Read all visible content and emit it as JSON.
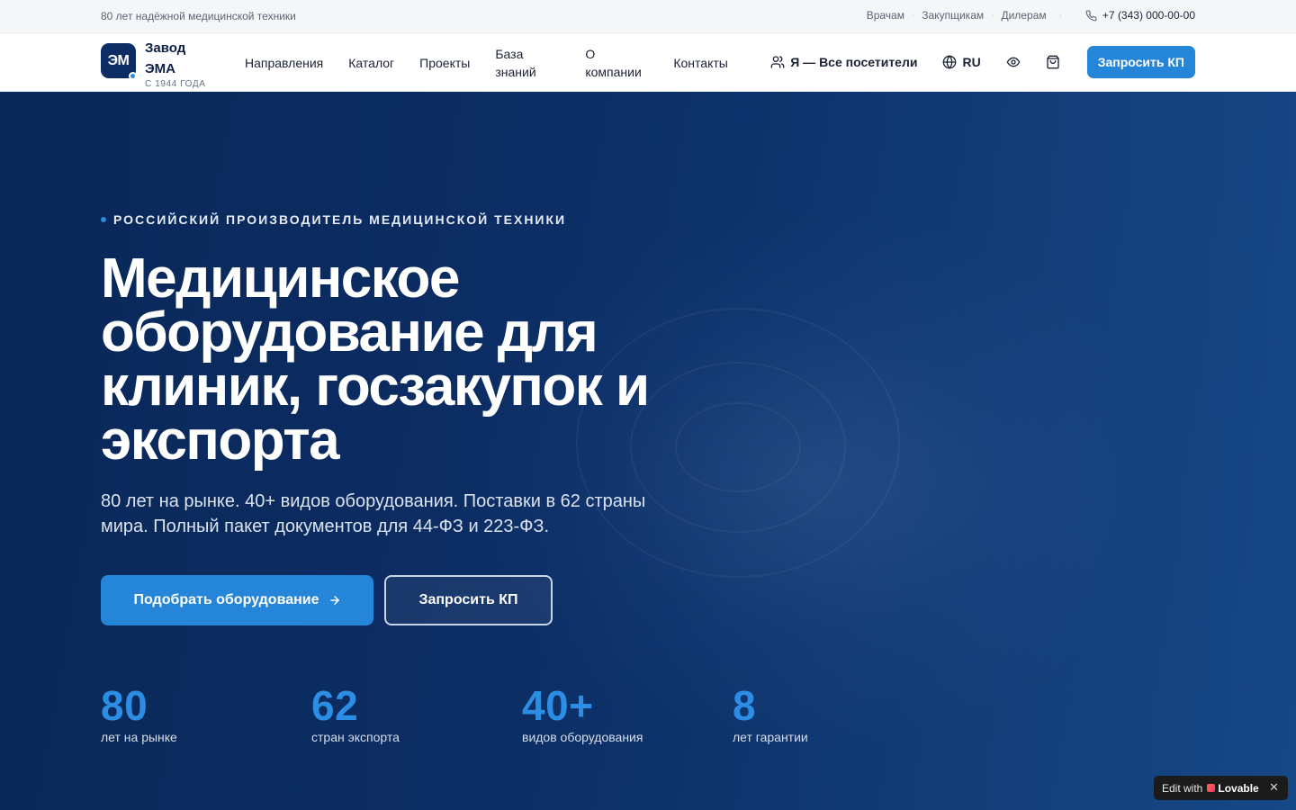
{
  "topbar": {
    "tagline": "80 лет надёжной медицинской техники",
    "links": [
      "Врачам",
      "Закупщикам",
      "Дилерам"
    ],
    "phone": "+7 (343) 000-00-00"
  },
  "nav": {
    "logo_mark": "ЭМ",
    "brand_line1": "Завод",
    "brand_line2": "ЭМА",
    "brand_since": "С 1944 ГОДА",
    "menu": [
      "Направления",
      "Каталог",
      "Проекты",
      "База знаний",
      "О компании",
      "Контакты"
    ],
    "audience": "Я — Все посетители",
    "language": "RU",
    "cta": "Запросить КП"
  },
  "hero": {
    "eyebrow": "РОССИЙСКИЙ ПРОИЗВОДИТЕЛЬ МЕДИЦИНСКОЙ ТЕХНИКИ",
    "headline": "Медицинское оборудование для клиник, госзакупок и экспорта",
    "lead": "80 лет на рынке. 40+ видов оборудования. Поставки в 62 страны мира. Полный пакет документов для 44-ФЗ и 223-ФЗ.",
    "primary_button": "Подобрать оборудование",
    "secondary_button": "Запросить КП",
    "stats": [
      {
        "value": "80",
        "label": "лет на рынке"
      },
      {
        "value": "62",
        "label": "стран экспорта"
      },
      {
        "value": "40+",
        "label": "видов оборудования"
      },
      {
        "value": "8",
        "label": "лет гарантии"
      }
    ]
  },
  "badge": {
    "prefix": "Edit with",
    "brand": "Lovable",
    "close": "✕"
  },
  "colors": {
    "accent": "#2585d8",
    "navy": "#0c2d64",
    "stat_number": "#2b8ee4"
  },
  "icons": [
    "phone-icon",
    "users-icon",
    "globe-icon",
    "eye-icon",
    "cart-icon",
    "arrow-right-icon",
    "close-icon"
  ]
}
